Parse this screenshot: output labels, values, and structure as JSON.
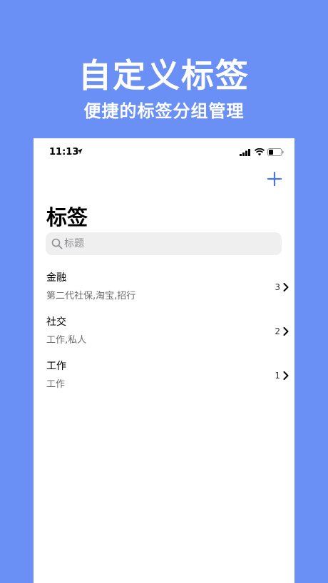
{
  "promo": {
    "title": "自定义标签",
    "subtitle": "便捷的标签分组管理"
  },
  "status_bar": {
    "time": "11:13"
  },
  "page": {
    "title": "标签"
  },
  "search": {
    "placeholder": "标题"
  },
  "tags": [
    {
      "name": "金融",
      "subtitle": "第二代社保,淘宝,招行",
      "count": "3"
    },
    {
      "name": "社交",
      "subtitle": "工作,私人",
      "count": "2"
    },
    {
      "name": "工作",
      "subtitle": "工作",
      "count": "1"
    }
  ],
  "colors": {
    "background": "#6a8ff5",
    "accent": "#4a76d8",
    "card": "#ffffff",
    "search_bg": "#efefef"
  },
  "icons": [
    "location-arrow-icon",
    "signal-icon",
    "wifi-icon",
    "battery-icon",
    "plus-icon",
    "search-icon",
    "chevron-right-icon"
  ]
}
